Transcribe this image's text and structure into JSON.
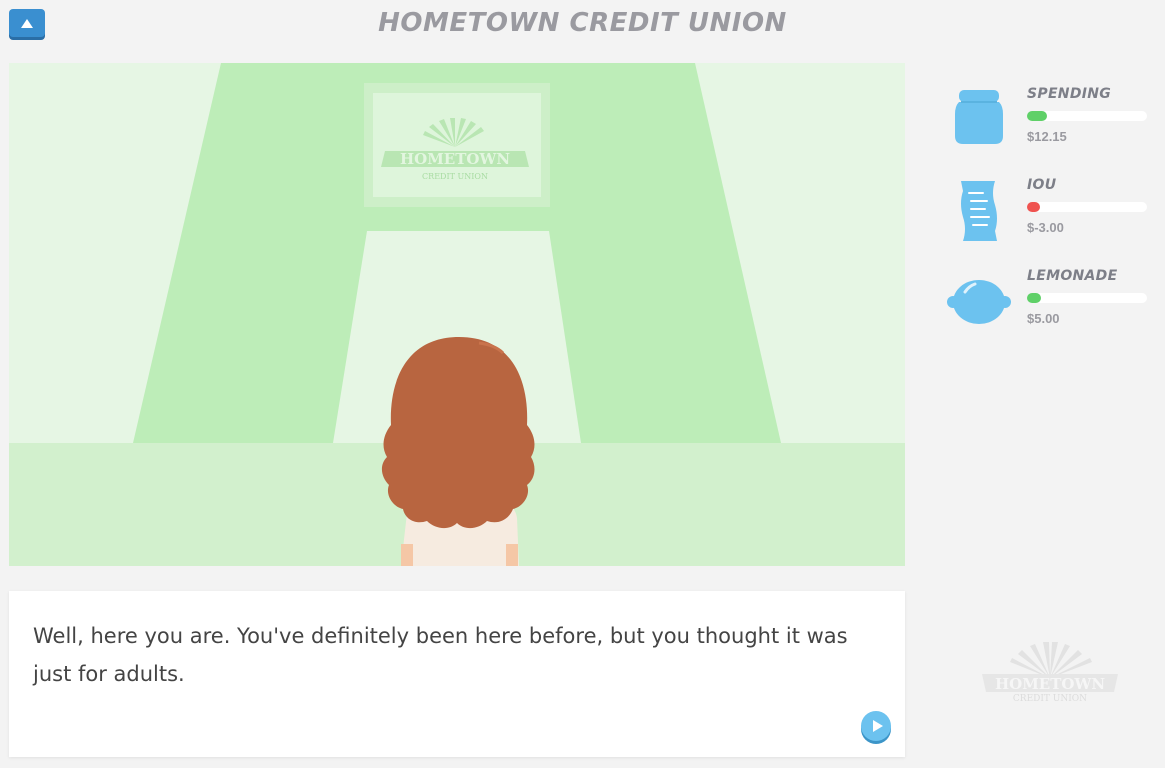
{
  "header": {
    "title": "HOMETOWN CREDIT UNION"
  },
  "scene": {
    "sign_logo_main": "HOMETOWN",
    "sign_logo_sub": "CREDIT UNION"
  },
  "stats": [
    {
      "label": "SPENDING",
      "value": "$12.15",
      "level": 0.17,
      "color": "#5fd068",
      "icon": "jar-icon"
    },
    {
      "label": "IOU",
      "value": "$-3.00",
      "level": 0.11,
      "color": "#ef5350",
      "icon": "receipt-icon"
    },
    {
      "label": "LEMONADE",
      "value": "$5.00",
      "level": 0.12,
      "color": "#5fd068",
      "icon": "lemon-icon"
    }
  ],
  "dialog": {
    "text": "Well, here you are. You've definitely been here before, but you thought it was just for adults."
  },
  "footer_logo": {
    "main": "HOMETOWN",
    "sub": "CREDIT UNION"
  },
  "colors": {
    "accent": "#3a8fd0",
    "play": "#6cc2ef",
    "scene_bg": "#e6f6e4",
    "scene_mid": "#bdedb8"
  }
}
